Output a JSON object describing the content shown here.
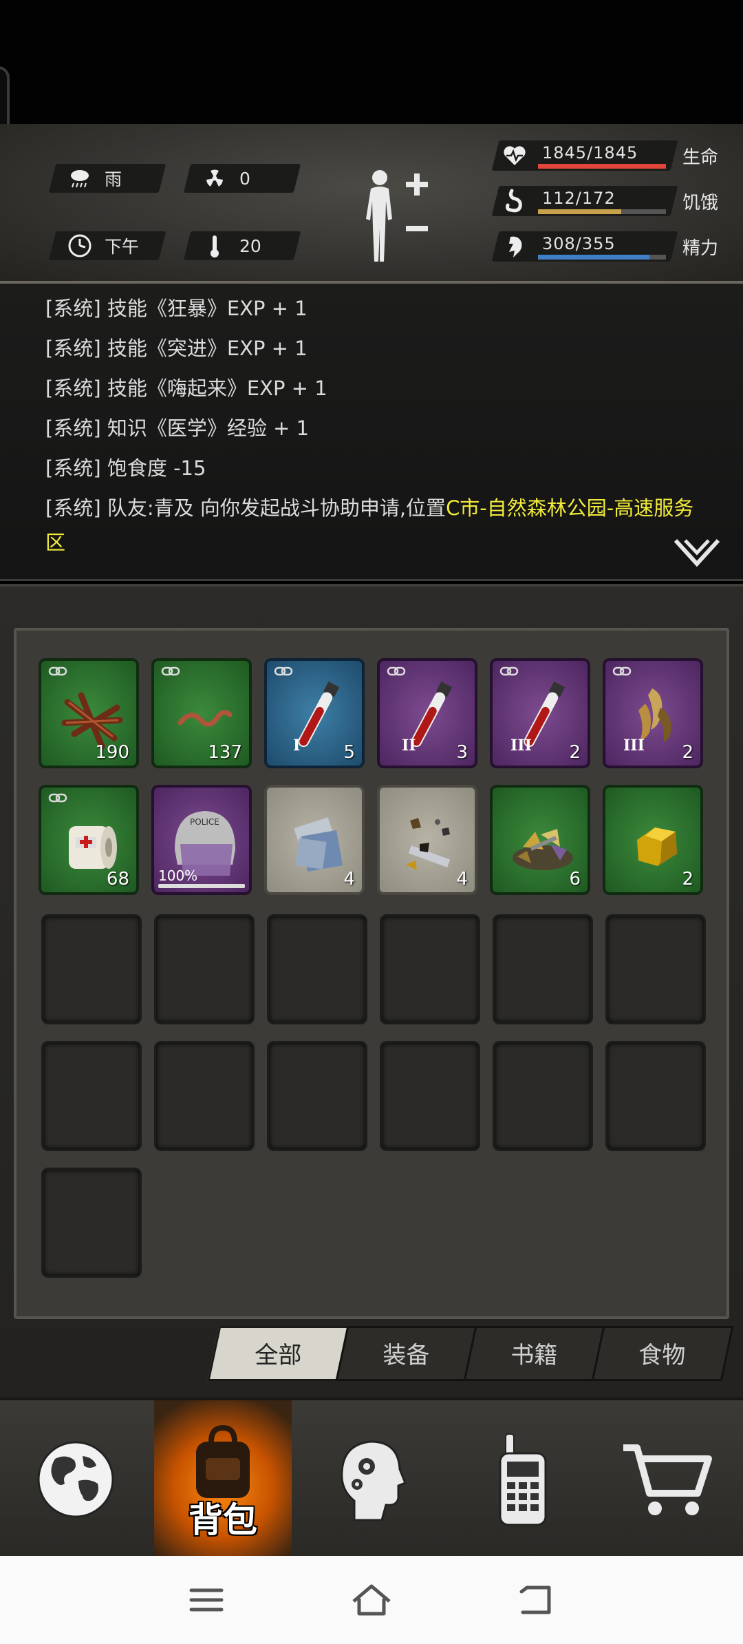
{
  "weather": {
    "condition_label": "雨",
    "radiation_value": "0",
    "time_label": "下午",
    "temperature_value": "20"
  },
  "stats": [
    {
      "name": "health",
      "value_text": "1845/1845",
      "label": "生命",
      "fraction": 1.0,
      "color": "#e2463a",
      "icon": "heart-pulse-icon"
    },
    {
      "name": "hunger",
      "value_text": "112/172",
      "label": "饥饿",
      "fraction": 0.65,
      "color": "#c8a24a",
      "icon": "stomach-icon"
    },
    {
      "name": "energy",
      "value_text": "308/355",
      "label": "精力",
      "fraction": 0.87,
      "color": "#3f7fc6",
      "icon": "energy-icon"
    }
  ],
  "log": {
    "lines": [
      "[系统] 技能《狂暴》EXP + 1",
      "[系统] 技能《突进》EXP + 1",
      "[系统] 技能《嗨起来》EXP + 1",
      "[系统] 知识《医学》经验 + 1",
      "[系统] 饱食度 -15"
    ],
    "last_prefix": "[系统] 队友:青及 向你发起战斗协助申请,位置",
    "last_highlight_1": "C市-自然森林公园-高速服务",
    "last_highlight_2": "区"
  },
  "inventory": {
    "items": [
      {
        "name": "wood-sticks",
        "rarity": "green",
        "count": "190",
        "linked": true
      },
      {
        "name": "worm",
        "rarity": "green",
        "count": "137",
        "linked": true
      },
      {
        "name": "blood-vial-i",
        "rarity": "blue",
        "count": "5",
        "linked": true,
        "tier": "I"
      },
      {
        "name": "blood-vial-ii",
        "rarity": "purple",
        "count": "3",
        "linked": true,
        "tier": "II"
      },
      {
        "name": "blood-vial-iii",
        "rarity": "purple",
        "count": "2",
        "linked": true,
        "tier": "III"
      },
      {
        "name": "claws-iii",
        "rarity": "purple",
        "count": "2",
        "linked": true,
        "tier": "III"
      },
      {
        "name": "bandage",
        "rarity": "green",
        "count": "68",
        "linked": true
      },
      {
        "name": "police-helmet",
        "rarity": "purple",
        "durability": "100%",
        "helmet_text": "POLICE"
      },
      {
        "name": "paper",
        "rarity": "white",
        "count": "4"
      },
      {
        "name": "scrap-metal",
        "rarity": "white",
        "count": "4"
      },
      {
        "name": "mixed-parts",
        "rarity": "green",
        "count": "6"
      },
      {
        "name": "gold-ore",
        "rarity": "green",
        "count": "2"
      }
    ],
    "empty_slots": 13
  },
  "tabs": {
    "all": "全部",
    "equipment": "装备",
    "books": "书籍",
    "food": "食物"
  },
  "nav": {
    "backpack_label": "背包"
  }
}
